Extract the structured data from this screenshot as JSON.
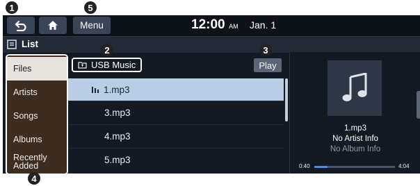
{
  "header": {
    "back_icon": "back-arrow-icon",
    "home_icon": "home-icon",
    "menu_label": "Menu",
    "time": "12:00",
    "ampm": "AM",
    "date": "Jan. 1"
  },
  "listbar": {
    "icon": "list-icon",
    "label": "List"
  },
  "sidebar": {
    "items": [
      {
        "label": "Files",
        "selected": true
      },
      {
        "label": "Artists",
        "selected": false
      },
      {
        "label": "Songs",
        "selected": false
      },
      {
        "label": "Albums",
        "selected": false
      },
      {
        "label": "Recently Added",
        "selected": false
      }
    ]
  },
  "folder": {
    "icon": "folder-icon",
    "label": "USB Music"
  },
  "play_label": "Play",
  "files": [
    {
      "name": "1.mp3",
      "playing": true
    },
    {
      "name": "3.mp3",
      "playing": false
    },
    {
      "name": "4.mp3",
      "playing": false
    },
    {
      "name": "5.mp3",
      "playing": false
    }
  ],
  "now_playing": {
    "art_icon": "music-note-icon",
    "title": "1.mp3",
    "artist": "No Artist Info",
    "album": "No Album Info",
    "elapsed": "0:40",
    "total": "4:04",
    "progress": 0.164
  },
  "callouts": [
    "1",
    "2",
    "3",
    "4",
    "5"
  ],
  "colors": {
    "selected_row": "#b9cde4",
    "sidebar_bg": "#3d2c20",
    "progress": "#4a90e2"
  }
}
